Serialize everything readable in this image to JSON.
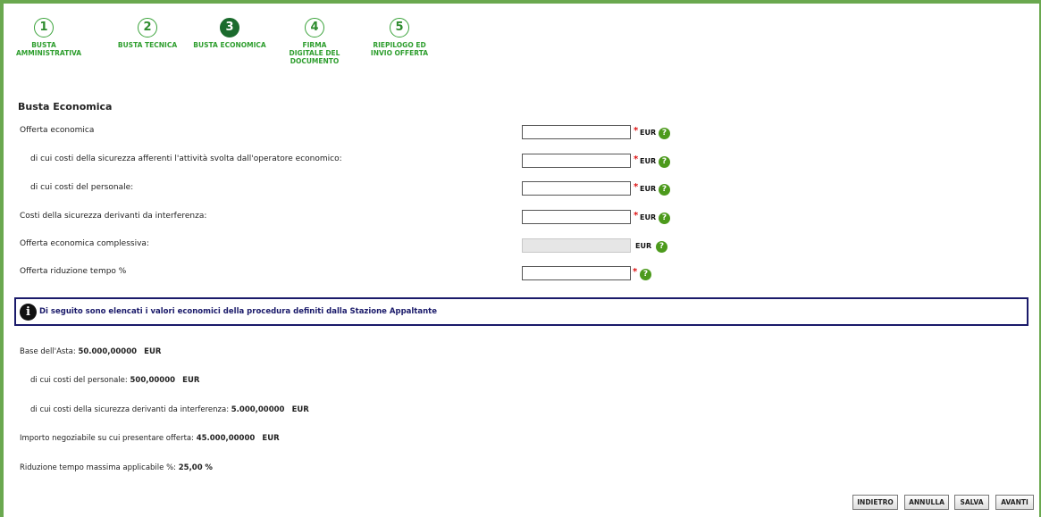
{
  "steps": [
    {
      "num": "1",
      "label": "BUSTA AMMINISTRATIVA"
    },
    {
      "num": "2",
      "label": "BUSTA TECNICA"
    },
    {
      "num": "3",
      "label": "BUSTA ECONOMICA"
    },
    {
      "num": "4",
      "label": "FIRMA DIGITALE DEL DOCUMENTO"
    },
    {
      "num": "5",
      "label": "RIEPILOGO ED INVIO OFFERTA"
    }
  ],
  "active_step": "3",
  "section_title": "Busta Economica",
  "fields": [
    {
      "label": "Offerta economica",
      "value": "",
      "required": "*",
      "unit": "EUR",
      "help": "?"
    },
    {
      "label": "di cui costi della sicurezza afferenti l'attività svolta dall'operatore economico:",
      "value": "",
      "required": "*",
      "unit": "EUR",
      "help": "?"
    },
    {
      "label": "di cui costi del personale:",
      "value": "",
      "required": "*",
      "unit": "EUR",
      "help": "?"
    },
    {
      "label": "Costi della sicurezza derivanti da interferenza:",
      "value": "",
      "required": "*",
      "unit": "EUR",
      "help": "?"
    },
    {
      "label": "Offerta economica complessiva:",
      "value": "",
      "required": "",
      "unit": "EUR",
      "help": "?"
    },
    {
      "label": "Offerta riduzione tempo %",
      "value": "",
      "required": "*",
      "unit": "",
      "help": "?"
    }
  ],
  "info": {
    "icon": "i",
    "text": "Di seguito sono elencati i valori economici della procedura definiti dalla Stazione Appaltante"
  },
  "values": [
    {
      "label": "Base dell'Asta:",
      "value": "50.000,00000",
      "unit": "EUR"
    },
    {
      "label": "di cui costi del personale:",
      "value": "500,00000",
      "unit": "EUR"
    },
    {
      "label": "di cui costi della sicurezza derivanti da interferenza:",
      "value": "5.000,00000",
      "unit": "EUR"
    },
    {
      "label": "Importo negoziabile su cui presentare offerta:",
      "value": "45.000,00000",
      "unit": "EUR"
    },
    {
      "label": "Riduzione tempo massima applicabile  %:",
      "value": "25,00",
      "unit": "%"
    }
  ],
  "buttons": {
    "back": "INDIETRO",
    "cancel": "ANNULLA",
    "save": "SALVA",
    "next": "AVANTI"
  },
  "colors": {
    "accent": "#6aa84f",
    "step_active": "#1b6b2d",
    "help": "#4c9a1c",
    "info_border": "#1a1a6a"
  }
}
